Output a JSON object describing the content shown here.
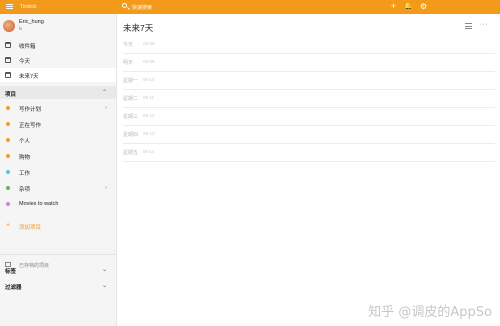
{
  "topbar": {
    "app_name": "Ticktick",
    "search_placeholder": "快速搜索"
  },
  "user": {
    "name": "Eric_hung",
    "sub": "lv"
  },
  "nav": [
    {
      "label": "收件箱",
      "icon": "inbox-icon"
    },
    {
      "label": "今天",
      "icon": "calendar-today-icon"
    },
    {
      "label": "未来7天",
      "icon": "calendar-week-icon"
    }
  ],
  "projects_header": {
    "label": "项目"
  },
  "projects": [
    {
      "label": "写作计划",
      "color": "#f39a1b",
      "has_arrow": true
    },
    {
      "label": "正在写作",
      "color": "#f39a1b",
      "has_arrow": false
    },
    {
      "label": "个人",
      "color": "#f39a1b",
      "has_arrow": false
    },
    {
      "label": "购物",
      "color": "#f39a1b",
      "has_arrow": false
    },
    {
      "label": "工作",
      "color": "#5bc0de",
      "has_arrow": false
    },
    {
      "label": "杂项",
      "color": "#5cb85c",
      "has_arrow": true
    },
    {
      "label": "Movies to watch",
      "color": "#d77ee0",
      "has_arrow": false
    }
  ],
  "add_project": {
    "label": "添加项目"
  },
  "archived": {
    "label": "已存档的项目"
  },
  "tags_header": {
    "label": "标签"
  },
  "filters_header": {
    "label": "过滤器"
  },
  "main": {
    "title": "未来7天",
    "days": [
      {
        "day": "今天",
        "date": "06-08"
      },
      {
        "day": "明天",
        "date": "06-09"
      },
      {
        "day": "星期一",
        "date": "06-10"
      },
      {
        "day": "星期二",
        "date": "06-11"
      },
      {
        "day": "星期三",
        "date": "06-12"
      },
      {
        "day": "星期四",
        "date": "06-13"
      },
      {
        "day": "星期五",
        "date": "06-14"
      }
    ]
  },
  "watermark": "知乎 @调皮的AppSo",
  "colors": {
    "accent": "#f39a1b"
  }
}
